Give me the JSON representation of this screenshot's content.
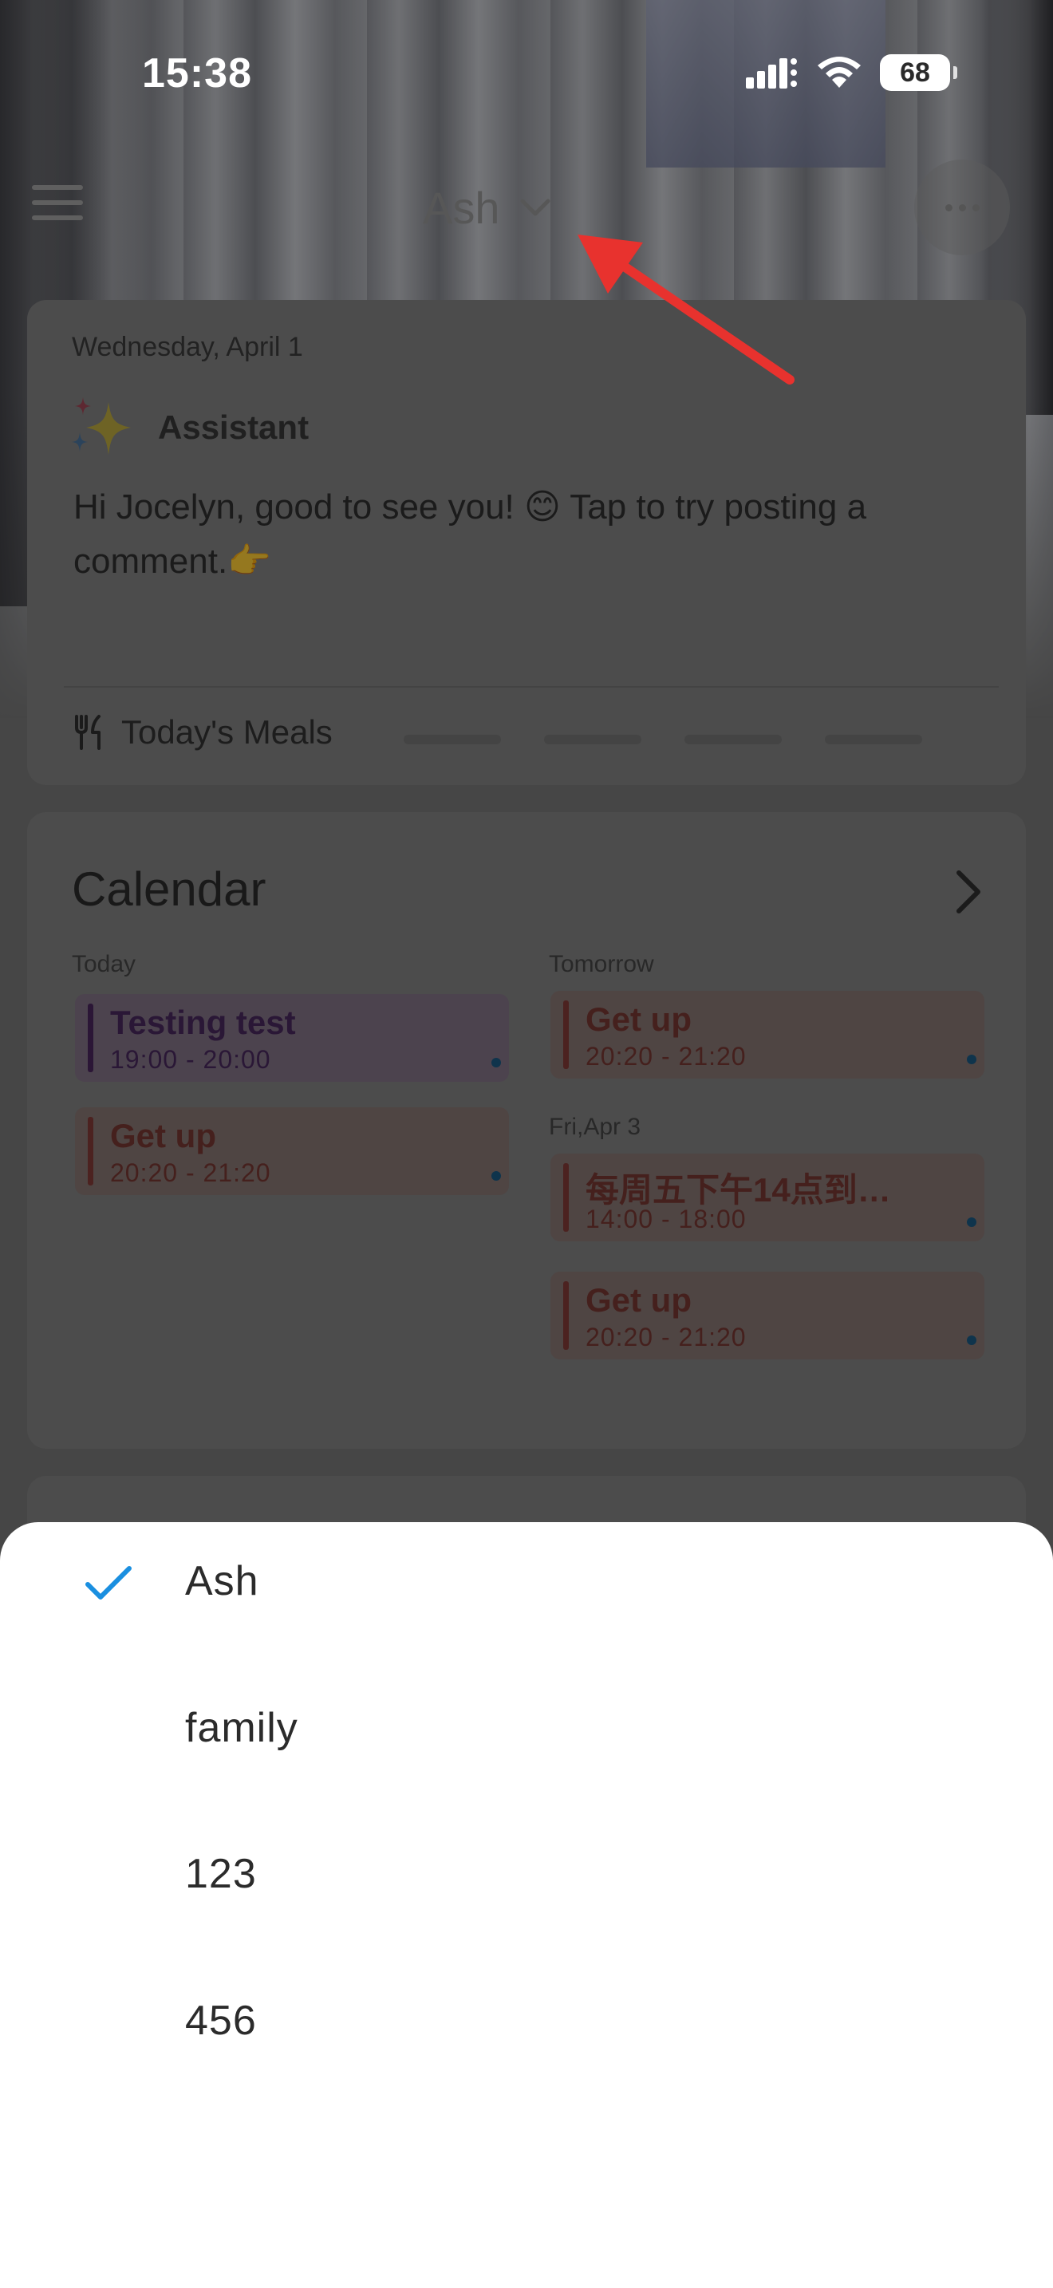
{
  "status_bar": {
    "time": "15:38",
    "battery": "68"
  },
  "header": {
    "title": "Ash",
    "menu_icon": "hamburger-menu-icon",
    "more_icon": "more-dots-icon"
  },
  "assistant_card": {
    "date": "Wednesday, April 1",
    "name": "Assistant",
    "message": "Hi Jocelyn, good to see you! 😊 Tap to try posting a comment.👉",
    "meals_label": "Today's Meals"
  },
  "calendar": {
    "title": "Calendar",
    "today_label": "Today",
    "tomorrow_label": "Tomorrow",
    "fri_label": "Fri,Apr 3",
    "today_events": [
      {
        "title": "Testing test",
        "time": "19:00 - 20:00"
      },
      {
        "title": "Get up",
        "time": "20:20 - 21:20"
      }
    ],
    "tomorrow_events": [
      {
        "title": "Get up",
        "time": "20:20 - 21:20"
      }
    ],
    "fri_events": [
      {
        "title": "每周五下午14点到…",
        "time": "14:00 - 18:00"
      },
      {
        "title": "Get up",
        "time": "20:20 - 21:20"
      }
    ]
  },
  "group_picker": {
    "selected": "Ash",
    "options": [
      "Ash",
      "family",
      "123",
      "456"
    ]
  },
  "colors": {
    "accent_check": "#1a8fe0",
    "annotation_arrow": "#e8322e"
  }
}
